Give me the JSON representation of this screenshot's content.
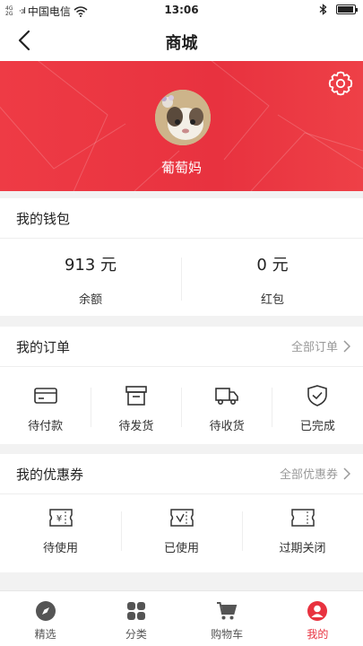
{
  "status_bar": {
    "carrier": "中国电信",
    "time": "13:06",
    "small_text": "4G 2G"
  },
  "nav": {
    "title": "商城"
  },
  "profile": {
    "nickname": "葡萄妈"
  },
  "wallet": {
    "header": "我的钱包",
    "items": [
      {
        "value": "913 元",
        "label": "余额"
      },
      {
        "value": "0 元",
        "label": "红包"
      }
    ]
  },
  "orders": {
    "header": "我的订单",
    "more": "全部订单",
    "items": [
      {
        "label": "待付款",
        "icon": "card-icon"
      },
      {
        "label": "待发货",
        "icon": "box-icon"
      },
      {
        "label": "待收货",
        "icon": "truck-icon"
      },
      {
        "label": "已完成",
        "icon": "shield-check-icon"
      }
    ]
  },
  "coupons": {
    "header": "我的优惠券",
    "more": "全部优惠券",
    "items": [
      {
        "label": "待使用",
        "icon": "coupon-yen-icon"
      },
      {
        "label": "已使用",
        "icon": "coupon-check-icon"
      },
      {
        "label": "过期关闭",
        "icon": "coupon-expired-icon"
      }
    ]
  },
  "tabs": [
    {
      "label": "精选",
      "icon": "compass-icon",
      "active": false
    },
    {
      "label": "分类",
      "icon": "grid-icon",
      "active": false
    },
    {
      "label": "购物车",
      "icon": "cart-icon",
      "active": false
    },
    {
      "label": "我的",
      "icon": "user-icon",
      "active": true
    }
  ],
  "colors": {
    "brand_red": "#e8323f",
    "text": "#222222",
    "muted": "#999999"
  }
}
